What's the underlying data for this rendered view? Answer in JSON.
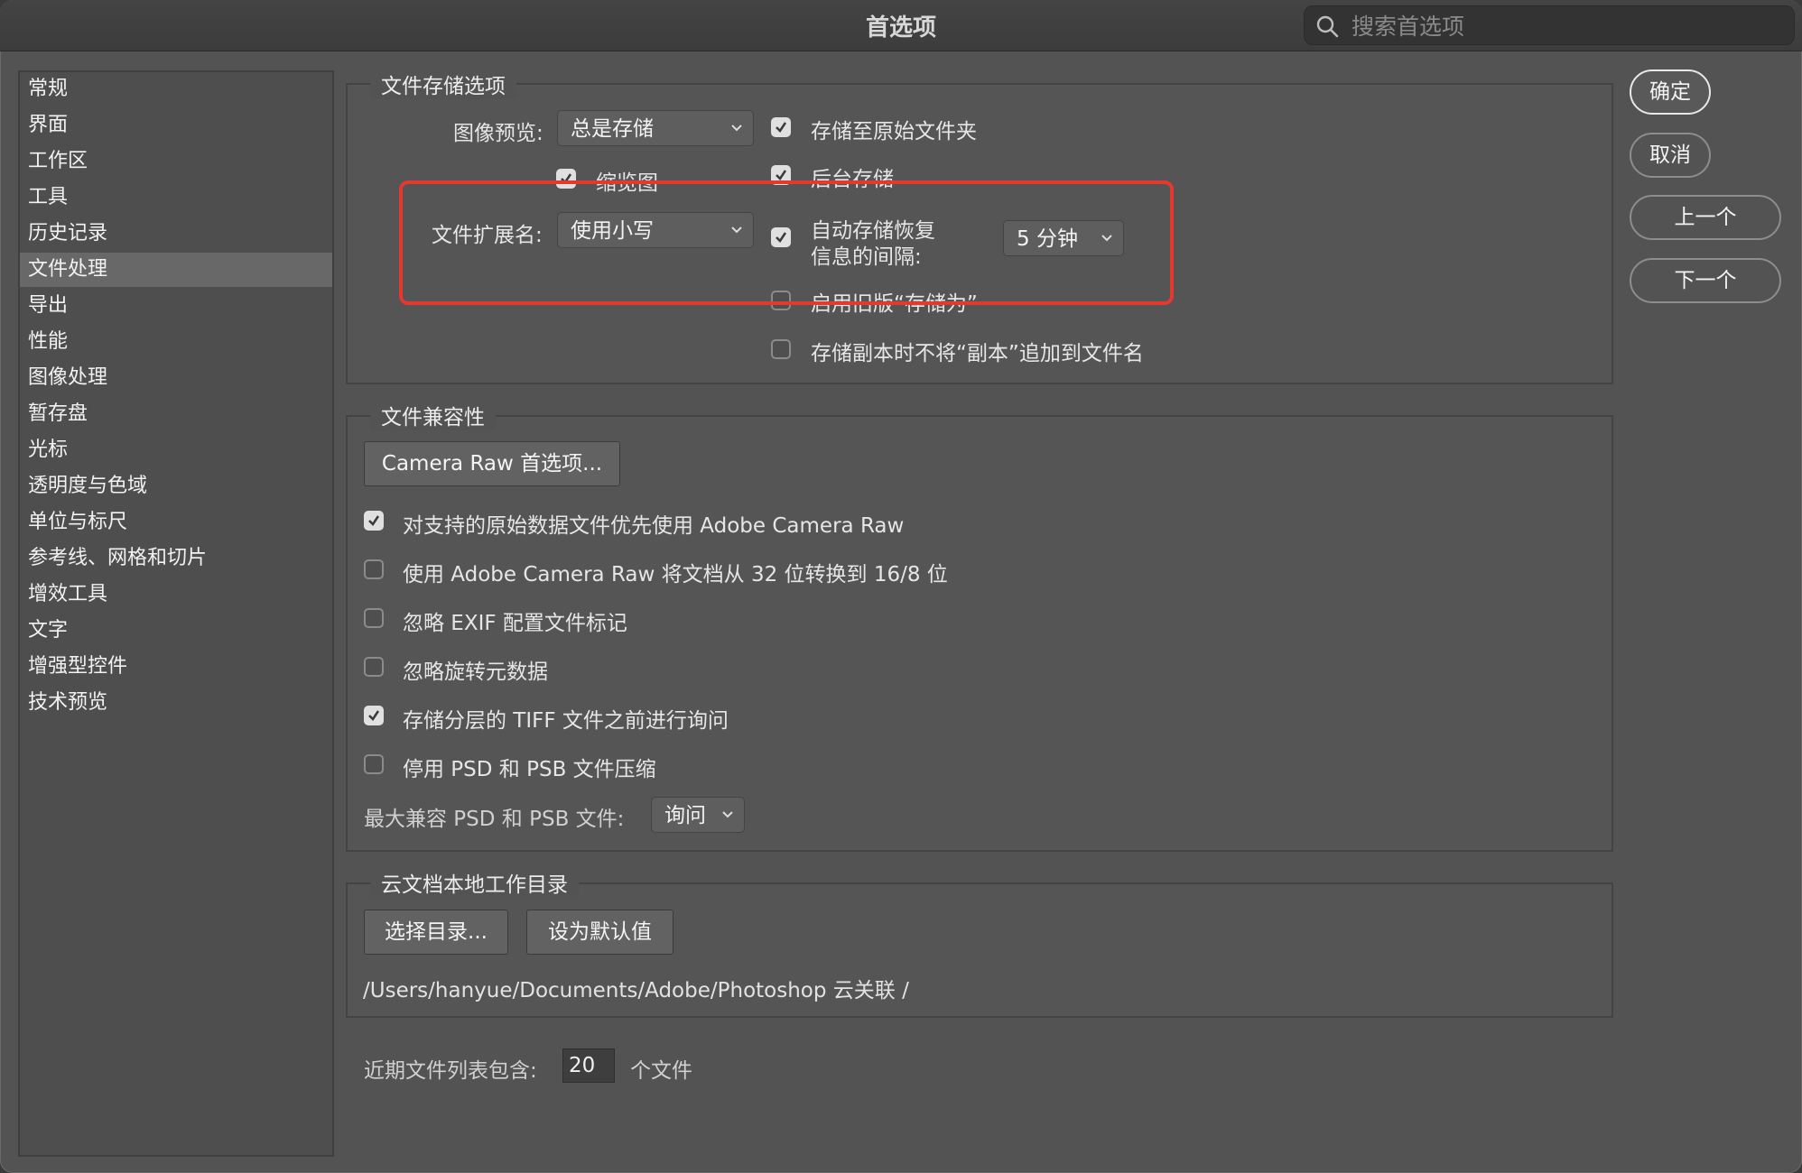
{
  "window": {
    "title": "首选项",
    "search_placeholder": "搜索首选项"
  },
  "sidebar": {
    "items": [
      {
        "label": "常规"
      },
      {
        "label": "界面"
      },
      {
        "label": "工作区"
      },
      {
        "label": "工具"
      },
      {
        "label": "历史记录"
      },
      {
        "label": "文件处理",
        "active": true
      },
      {
        "label": "导出"
      },
      {
        "label": "性能"
      },
      {
        "label": "图像处理"
      },
      {
        "label": "暂存盘"
      },
      {
        "label": "光标"
      },
      {
        "label": "透明度与色域"
      },
      {
        "label": "单位与标尺"
      },
      {
        "label": "参考线、网格和切片"
      },
      {
        "label": "增效工具"
      },
      {
        "label": "文字"
      },
      {
        "label": "增强型控件"
      },
      {
        "label": "技术预览"
      }
    ]
  },
  "file_saving": {
    "title": "文件存储选项",
    "image_preview_label": "图像预览:",
    "image_preview_value": "总是存储",
    "thumbnail_label": "缩览图",
    "thumbnail_checked": true,
    "extension_label": "文件扩展名:",
    "extension_value": "使用小写",
    "save_to_original_label": "存储至原始文件夹",
    "save_to_original_checked": true,
    "background_save_label": "后台存储",
    "background_save_checked": true,
    "auto_recovery_label_1": "自动存储恢复",
    "auto_recovery_label_2": "信息的间隔:",
    "auto_recovery_checked": true,
    "auto_recovery_interval": "5 分钟",
    "legacy_save_as_label": "启用旧版“存储为”",
    "legacy_save_as_checked": false,
    "no_copy_suffix_label": "存储副本时不将“副本”追加到文件名",
    "no_copy_suffix_checked": false
  },
  "compat": {
    "title": "文件兼容性",
    "camera_raw_button": "Camera Raw 首选项...",
    "options": [
      {
        "label": "对支持的原始数据文件优先使用 Adobe Camera Raw",
        "checked": true
      },
      {
        "label": "使用 Adobe Camera Raw 将文档从 32 位转换到 16/8 位",
        "checked": false
      },
      {
        "label": "忽略 EXIF 配置文件标记",
        "checked": false
      },
      {
        "label": "忽略旋转元数据",
        "checked": false
      },
      {
        "label": "存储分层的 TIFF 文件之前进行询问",
        "checked": true
      },
      {
        "label": "停用 PSD 和 PSB 文件压缩",
        "checked": false
      }
    ],
    "max_compat_label": "最大兼容 PSD 和 PSB 文件:",
    "max_compat_value": "询问"
  },
  "cloud": {
    "title": "云文档本地工作目录",
    "choose_button": "选择目录...",
    "default_button": "设为默认值",
    "path": "/Users/hanyue/Documents/Adobe/Photoshop 云关联 /"
  },
  "recent": {
    "label": "近期文件列表包含:",
    "value": "20",
    "suffix": "个文件"
  },
  "actions": {
    "ok": "确定",
    "cancel": "取消",
    "prev": "上一个",
    "next": "下一个"
  },
  "colors": {
    "highlight": "#e5382e",
    "window_bg": "#535353"
  }
}
